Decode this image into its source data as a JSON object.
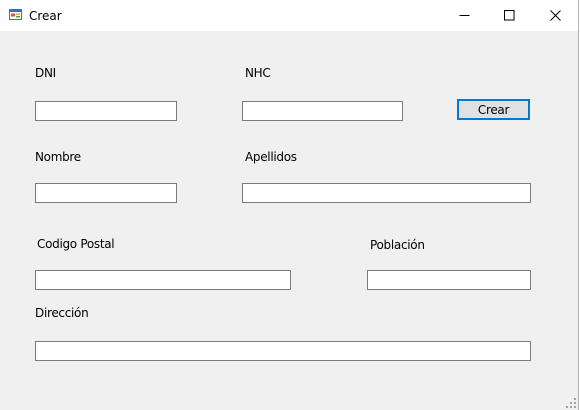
{
  "window": {
    "title": "Crear",
    "icons": {
      "app": "form-icon",
      "minimize": "minimize-icon",
      "maximize": "maximize-icon",
      "close": "close-icon"
    }
  },
  "form": {
    "labels": {
      "dni": "DNI",
      "nhc": "NHC",
      "nombre": "Nombre",
      "apellidos": "Apellidos",
      "codigo_postal": "Codigo Postal",
      "poblacion": "Población",
      "direccion": "Dirección"
    },
    "values": {
      "dni": "",
      "nhc": "",
      "nombre": "",
      "apellidos": "",
      "codigo_postal": "",
      "poblacion": "",
      "direccion": ""
    },
    "buttons": {
      "crear": "Crear"
    }
  },
  "colors": {
    "focus_border": "#0078d7",
    "client_bg": "#f0f0f0",
    "input_border": "#7a7a7a"
  }
}
